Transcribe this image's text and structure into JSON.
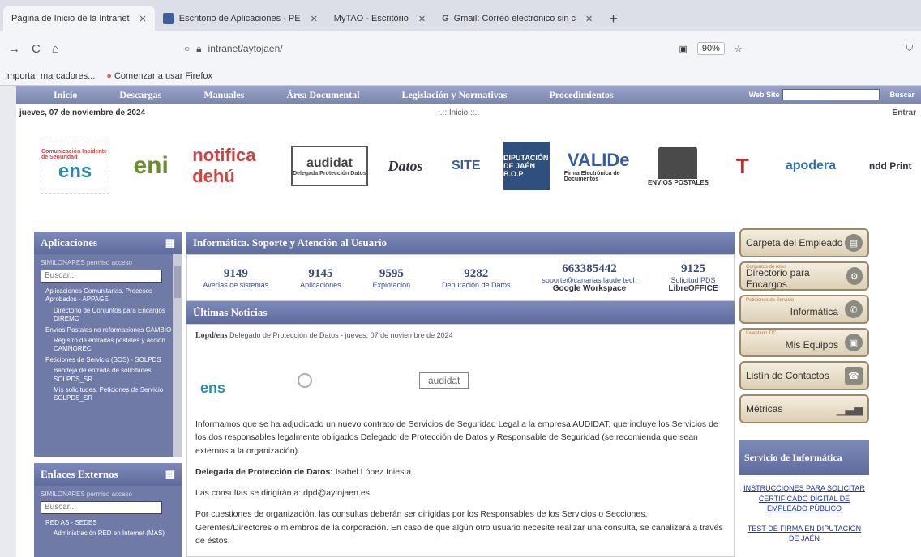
{
  "browser": {
    "tabs": [
      {
        "label": "Página de Inicio de la Intranet",
        "active": true
      },
      {
        "label": "Escritorio de Aplicaciones - PE",
        "active": false
      },
      {
        "label": "MyTAO - Escritorio",
        "active": false
      },
      {
        "label": "Gmail: Correo electrónico sin c",
        "active": false
      }
    ],
    "new_tab": "+",
    "url": "intranet/aytojaen/",
    "zoom": "90%",
    "bookmarks": [
      "Importar marcadores...",
      "Comenzar a usar Firefox"
    ]
  },
  "menu": {
    "items": [
      "Inicio",
      "Descargas",
      "Manuales",
      "Área Documental",
      "Legislación y Normativas",
      "Procedimientos"
    ],
    "search_options": "Web  Site",
    "search_button": "Buscar"
  },
  "date": "jueves, 07 de noviembre de 2024",
  "inicio_link": "..:: Inicio ::..",
  "entrar": "Entrar",
  "logos": {
    "ens": "ens",
    "ens_sub": "Comunicación Incidente de Seguridad",
    "eni": "eni",
    "dehu": "notifica dehú",
    "audidat": "audidat",
    "audidat_sub": "Delegada Protección Datos",
    "datos": "Datos",
    "site": "SITE",
    "bop": "DIPUTACIÓN DE JAÉN B.O.P",
    "valide": "VALIDe",
    "valide_sub": "Firma Electrónica de Documentos",
    "envios": "ENVÍOS POSTALES",
    "apodera": "apodera",
    "ndd": "ndd Print"
  },
  "sidebar": {
    "apps_title": "Aplicaciones",
    "apps_label": "SIMILONARES permiso acceso",
    "search_placeholder": "Buscar...",
    "apps_items": [
      "Aplicaciones Comunitarias. Procesos Aprobados - APPAGE",
      "Directorio de Conjuntos para Encargos DIREMC",
      "Envíos Postales no reformaciones CAMBIO",
      "Registro de entradas postales y acción CAMNOREC",
      "Peticiones de Servicio (SOS) - SOLPDS",
      "Bandeja de entrada de solicitudes SOLPDS_SR",
      "Mis solicitudes. Peticiones de Servicio SOLPDS_SR"
    ],
    "enlaces_title": "Enlaces Externos",
    "enlaces_label": "SIMILONARES permiso acceso",
    "enlaces_search": "Buscar...",
    "enlaces_items": [
      "RED AS - SEDES",
      "Administración RED en Internet (MAS)"
    ]
  },
  "support": {
    "title": "Informática. Soporte y Atención al Usuario",
    "stats": [
      {
        "num": "9149",
        "cap": "Averías de sistemas"
      },
      {
        "num": "9145",
        "cap": "Aplicaciones"
      },
      {
        "num": "9595",
        "cap": "Explotación"
      },
      {
        "num": "9282",
        "cap": "Depuración de Datos"
      },
      {
        "num": "663385442",
        "cap": "soporte@canarias laude tech",
        "cap2": "Google Workspace"
      },
      {
        "num": "9125",
        "cap": "Solicitud PDS",
        "cap2": "LibreOFFICE"
      }
    ]
  },
  "news": {
    "title": "Últimas Noticias",
    "source": "Lopd/ens",
    "meta": "Delegado de Protección de Datos - jueves, 07 de noviembre de 2024",
    "logo_ens": "ens",
    "logo_audidat": "audidat",
    "p1": "Informamos que se ha adjudicado un nuevo contrato de Servicios de Seguridad Legal a la empresa AUDIDAT, que incluye los Servicios de los dos responsables legalmente obligados Delegado de Protección de Datos y Responsable de Seguridad (se recomienda que sean externos a la organización).",
    "dpd_label": "Delegada de Protección de Datos:",
    "dpd_name": " Isabel López Iniesta",
    "p3": "Las consultas se dirigirán a: dpd@aytojaen.es",
    "p4": "Por cuestiones de organización, las consultas deberán ser dirigidas por los Responsables de los Servicios o Secciones, Gerentes/Directores o miembros de la corporación. En caso de que algún otro usuario necesite realizar una consulta, se canalizará a través de éstos."
  },
  "right": {
    "buttons": [
      {
        "tag": "",
        "label": "Carpeta del Empleado"
      },
      {
        "tag": "Conjuntos de roles",
        "label": "Directorio para Encargos"
      },
      {
        "tag": "Peticiones de Servicio",
        "label": "Informática"
      },
      {
        "tag": "Inventario TIC",
        "label": "Mis Equipos"
      },
      {
        "tag": "",
        "label": "Listín de Contactos"
      },
      {
        "tag": "",
        "label": "Métricas"
      }
    ],
    "servicio_title": "Servicio de Informática",
    "links": [
      "INSTRUCCIONES PARA SOLICITAR CERTIFICADO DIGITAL DE EMPLEADO PÚBLICO",
      "TEST DE FIRMA EN DIPUTACIÓN DE JAÉN"
    ]
  }
}
